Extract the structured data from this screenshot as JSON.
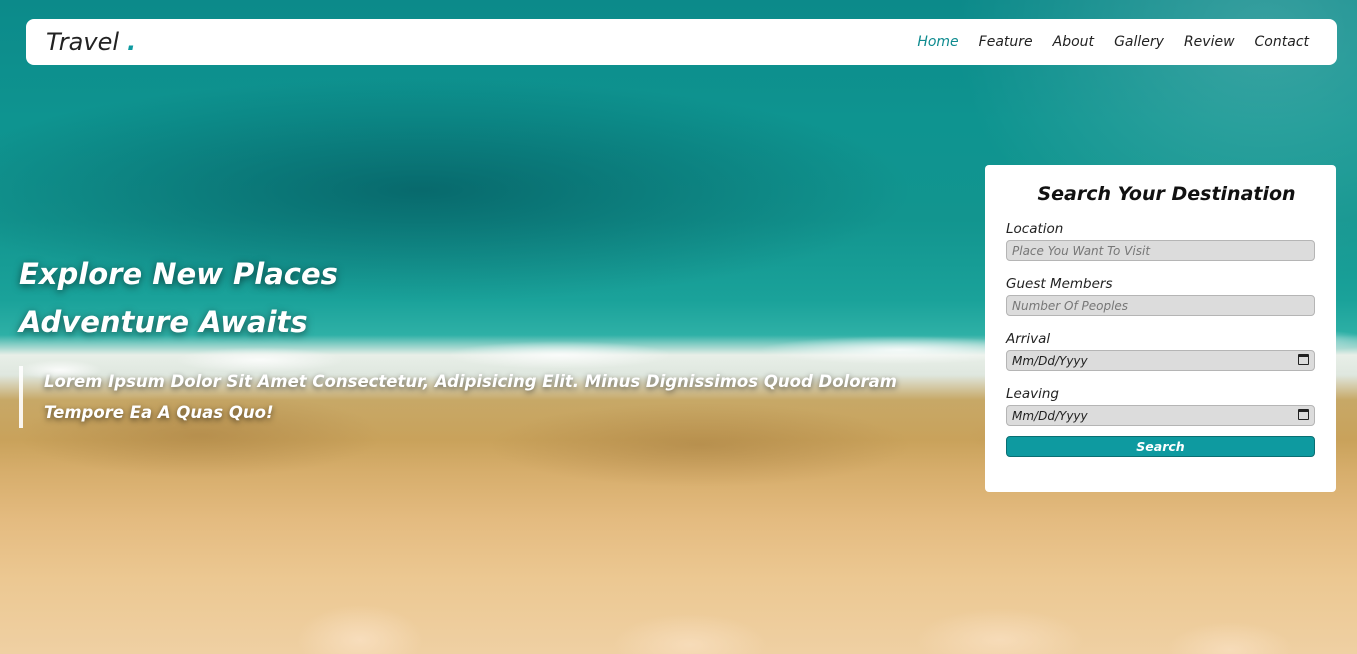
{
  "header": {
    "logo": "Travel",
    "logo_dot": ".",
    "nav": [
      {
        "label": "Home",
        "active": true
      },
      {
        "label": "Feature"
      },
      {
        "label": "About"
      },
      {
        "label": "Gallery"
      },
      {
        "label": "Review"
      },
      {
        "label": "Contact"
      }
    ]
  },
  "hero": {
    "title_line1": "Explore New Places",
    "title_line2": "Adventure Awaits",
    "description": "Lorem Ipsum Dolor Sit Amet Consectetur, Adipisicing Elit. Minus Dignissimos Quod Doloram Tempore Ea A Quas Quo!"
  },
  "search": {
    "title": "Search Your Destination",
    "location": {
      "label": "Location",
      "placeholder": "Place You Want To Visit"
    },
    "guests": {
      "label": "Guest Members",
      "placeholder": "Number Of Peoples"
    },
    "arrival": {
      "label": "Arrival",
      "value": "Mm/Dd/Yyyy"
    },
    "leaving": {
      "label": "Leaving",
      "value": "Mm/Dd/Yyyy"
    },
    "button": "Search"
  },
  "colors": {
    "accent": "#0e9aa0",
    "nav_active": "#0e8b8f",
    "sea": "#0e9490",
    "sand": "#e4bb80"
  },
  "icons": {
    "calendar": "calendar-icon"
  }
}
